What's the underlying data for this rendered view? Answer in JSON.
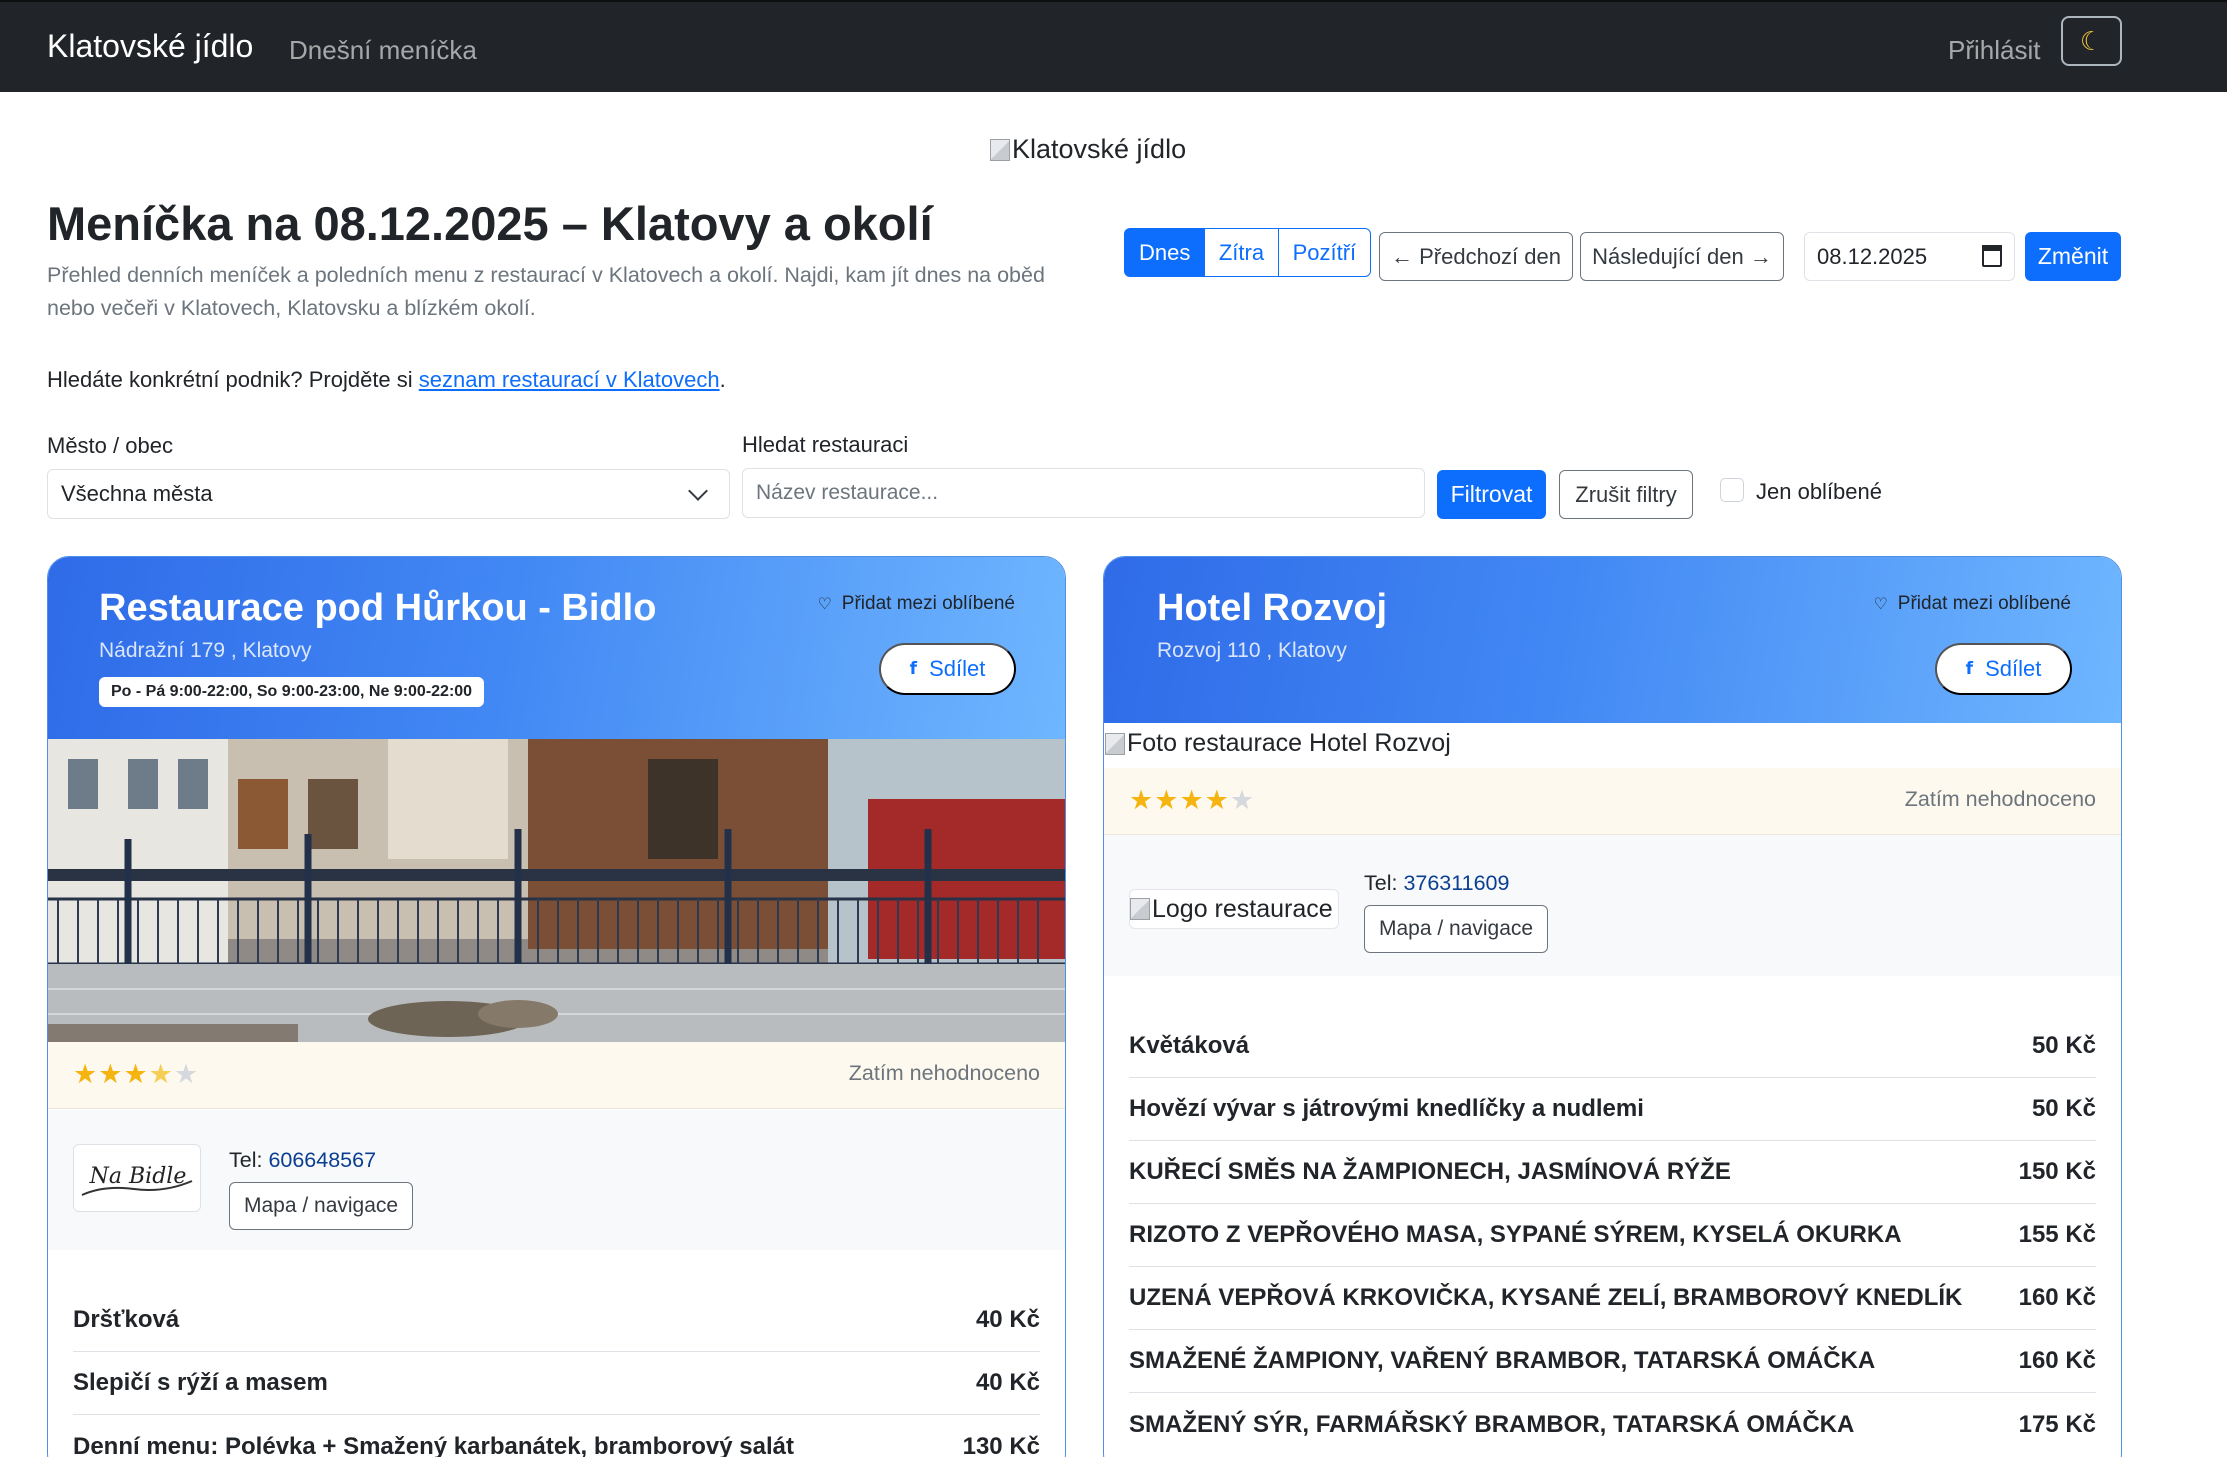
{
  "navbar": {
    "brand": "Klatovské jídlo",
    "today_link": "Dnešní meníčka",
    "login": "Přihlásit",
    "theme_icon": "moon-icon"
  },
  "header": {
    "logo_alt": "Klatovské jídlo",
    "title": "Meníčka na 08.12.2025 – Klatovy a okolí",
    "description": "Přehled denních meníček a poledních menu z restaurací v Klatovech a okolí. Najdi, kam jít dnes na oběd nebo večeři v Klatovech, Klatovsku a blízkém okolí.",
    "hint_prefix": "Hledáte konkrétní podnik? Projděte si ",
    "hint_link": "seznam restaurací v Klatovech",
    "hint_suffix": "."
  },
  "date_nav": {
    "days": [
      "Dnes",
      "Zítra",
      "Pozítří"
    ],
    "active_day": "Dnes",
    "prev": "← Předchozí den",
    "next": "Následující den →",
    "date_value": "08.12.2025",
    "change": "Změnit"
  },
  "filters": {
    "city_label": "Město / obec",
    "city_value": "Všechna města",
    "search_label": "Hledat restauraci",
    "search_placeholder": "Název restaurace...",
    "filter_button": "Filtrovat",
    "reset_button": "Zrušit filtry",
    "favorites_only": "Jen oblíbené"
  },
  "restaurants": [
    {
      "name": "Restaurace pod Hůrkou - Bidlo",
      "address": "Nádražní 179 , Klatovy",
      "hours": "Po - Pá 9:00-22:00, So 9:00-23:00, Ne 9:00-22:00",
      "favorite_label": "Přidat mezi oblíbené",
      "share_label": "Sdílet",
      "rating_stars": 3.5,
      "rating_text": "Zatím nehodnoceno",
      "tel_label": "Tel: ",
      "tel": "606648567",
      "map_label": "Mapa / navigace",
      "logo_text": "Na Bidle",
      "menu": [
        {
          "item": "Dršťková",
          "price": "40 Kč"
        },
        {
          "item": "Slepičí s rýží a masem",
          "price": "40 Kč"
        },
        {
          "item": "Denní menu: Polévka + Smažený karbanátek, bramborový salát",
          "price": "130 Kč"
        }
      ]
    },
    {
      "name": "Hotel Rozvoj",
      "address": "Rozvoj 110 , Klatovy",
      "favorite_label": "Přidat mezi oblíbené",
      "share_label": "Sdílet",
      "photo_alt": "Foto restaurace Hotel Rozvoj",
      "rating_stars": 4,
      "rating_text": "Zatím nehodnoceno",
      "logo_alt": "Logo restaurace",
      "tel_label": "Tel: ",
      "tel": "376311609",
      "map_label": "Mapa / navigace",
      "menu": [
        {
          "item": "Květáková",
          "price": "50 Kč"
        },
        {
          "item": "Hovězí vývar s játrovými knedlíčky a nudlemi",
          "price": "50 Kč"
        },
        {
          "item": "KUŘECÍ SMĚS NA ŽAMPIONECH, JASMÍNOVÁ RÝŽE",
          "price": "150 Kč"
        },
        {
          "item": "RIZOTO Z VEPŘOVÉHO MASA, SYPANÉ SÝREM, KYSELÁ OKURKA",
          "price": "155 Kč"
        },
        {
          "item": "UZENÁ VEPŘOVÁ KRKOVIČKA, KYSANÉ ZELÍ, BRAMBOROVÝ KNEDLÍK",
          "price": "160 Kč"
        },
        {
          "item": "SMAŽENÉ ŽAMPIONY, VAŘENÝ BRAMBOR, TATARSKÁ OMÁČKA",
          "price": "160 Kč"
        },
        {
          "item": "SMAŽENÝ SÝR, FARMÁŘSKÝ BRAMBOR, TATARSKÁ OMÁČKA",
          "price": "175 Kč"
        }
      ]
    }
  ],
  "colors": {
    "navbar": "#212529",
    "primary": "#0d6efd",
    "star": "#f5b40f"
  }
}
